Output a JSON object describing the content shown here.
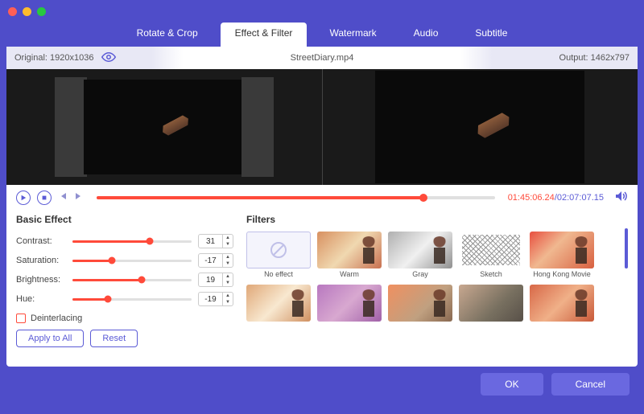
{
  "tabs": {
    "rotate": "Rotate & Crop",
    "effect": "Effect & Filter",
    "watermark": "Watermark",
    "audio": "Audio",
    "subtitle": "Subtitle"
  },
  "info": {
    "original_label": "Original: 1920x1036",
    "filename": "StreetDiary.mp4",
    "output_label": "Output: 1462x797"
  },
  "playback": {
    "current_time": "01:45:06.24",
    "total_time": "02:07:07.15",
    "progress_pct": 82
  },
  "basic_effect": {
    "title": "Basic Effect",
    "contrast": {
      "label": "Contrast:",
      "value": "31",
      "pct": 65
    },
    "saturation": {
      "label": "Saturation:",
      "value": "-17",
      "pct": 33
    },
    "brightness": {
      "label": "Brightness:",
      "value": "19",
      "pct": 58
    },
    "hue": {
      "label": "Hue:",
      "value": "-19",
      "pct": 30
    },
    "deinterlacing_label": "Deinterlacing",
    "apply_all": "Apply to All",
    "reset": "Reset"
  },
  "filters": {
    "title": "Filters",
    "no_effect": "No effect",
    "warm": "Warm",
    "gray": "Gray",
    "sketch": "Sketch",
    "hong_kong": "Hong Kong Movie"
  },
  "footer": {
    "ok": "OK",
    "cancel": "Cancel"
  }
}
